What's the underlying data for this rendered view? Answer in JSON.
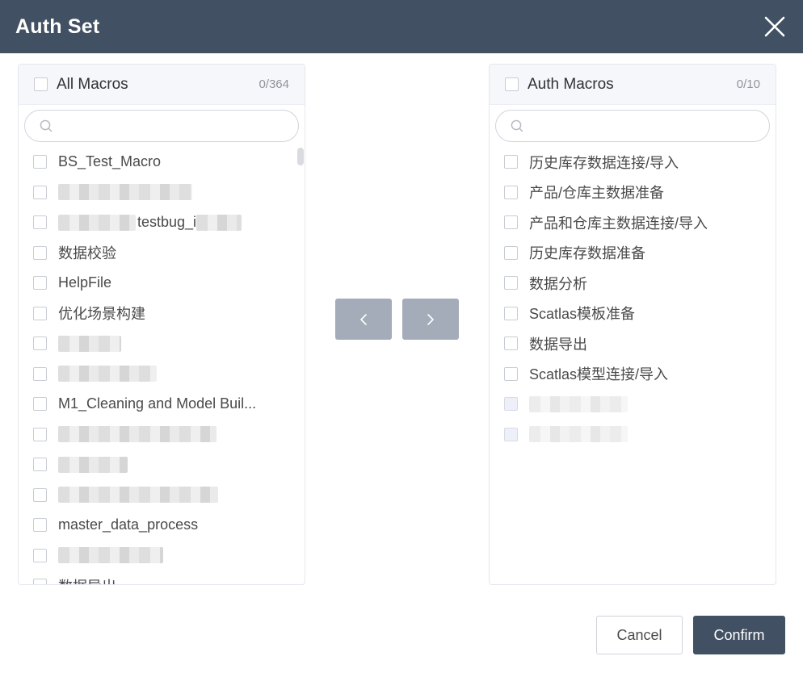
{
  "dialog": {
    "title": "Auth Set",
    "cancel_label": "Cancel",
    "confirm_label": "Confirm"
  },
  "left_panel": {
    "title": "All Macros",
    "count": "0/364",
    "items": [
      {
        "label": "BS_Test_Macro"
      },
      {
        "label": ""
      },
      {
        "label": "testbug_i"
      },
      {
        "label": "数据校验"
      },
      {
        "label": "HelpFile"
      },
      {
        "label": "优化场景构建"
      },
      {
        "label": ""
      },
      {
        "label": ""
      },
      {
        "label": "M1_Cleaning and Model Buil..."
      },
      {
        "label": ""
      },
      {
        "label": ""
      },
      {
        "label": ""
      },
      {
        "label": "master_data_process"
      },
      {
        "label": ""
      },
      {
        "label": "数据导出"
      }
    ]
  },
  "right_panel": {
    "title": "Auth Macros",
    "count": "0/10",
    "items": [
      {
        "label": "历史库存数据连接/导入"
      },
      {
        "label": "产品/仓库主数据准备"
      },
      {
        "label": "产品和仓库主数据连接/导入"
      },
      {
        "label": "历史库存数据准备"
      },
      {
        "label": "数据分析"
      },
      {
        "label": "Scatlas模板准备"
      },
      {
        "label": "数据导出"
      },
      {
        "label": "Scatlas模型连接/导入"
      },
      {
        "label": ""
      },
      {
        "label": ""
      }
    ]
  },
  "icons": {
    "close": "close-icon",
    "search": "search-icon",
    "prev": "chevron-left-icon",
    "next": "chevron-right-icon"
  },
  "colors": {
    "header_bg": "#415062",
    "transfer_button": "#a3acb8",
    "confirm_bg": "#415062"
  }
}
